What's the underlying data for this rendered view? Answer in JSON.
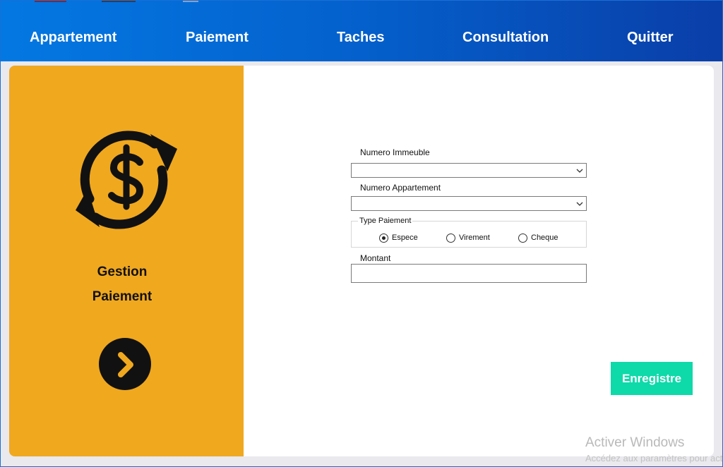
{
  "nav": {
    "items": [
      "Appartement",
      "Paiement",
      "Taches",
      "Consultation",
      "Quitter"
    ]
  },
  "side_panel": {
    "icon": "money-exchange-icon",
    "title_line1": "Gestion",
    "title_line2": "Paiement",
    "next_icon": "chevron-right-icon",
    "color": "#f0a81f"
  },
  "form": {
    "numero_immeuble": {
      "label": "Numero Immeuble",
      "value": ""
    },
    "numero_appartement": {
      "label": "Numero Appartement",
      "value": ""
    },
    "type_paiement": {
      "label": "Type Paiement",
      "options": [
        {
          "label": "Espece",
          "selected": true
        },
        {
          "label": "Virement",
          "selected": false
        },
        {
          "label": "Cheque",
          "selected": false
        }
      ]
    },
    "montant": {
      "label": "Montant",
      "value": ""
    },
    "save_label": "Enregistre"
  },
  "watermark": {
    "title": "Activer Windows",
    "subtitle": "Accédez aux paramètres pour activer Windows."
  },
  "colors": {
    "header_start": "#0478e2",
    "header_end": "#0a3ea8",
    "accent": "#f0a81f",
    "save_button": "#0ed9a9"
  }
}
